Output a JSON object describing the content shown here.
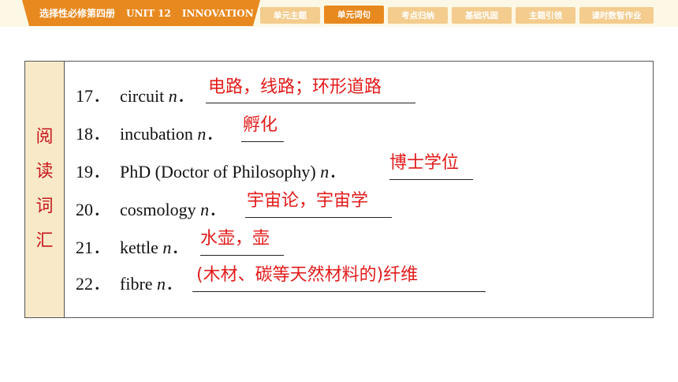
{
  "header": {
    "title_cn": "选择性必修第四册",
    "title_unit": "UNIT 12",
    "title_theme": "INNOVATION"
  },
  "nav": {
    "tabs": [
      {
        "label": "单元主题",
        "active": false
      },
      {
        "label": "单元词句",
        "active": true
      },
      {
        "label": "考点归纳",
        "active": false
      },
      {
        "label": "基础巩固",
        "active": false
      },
      {
        "label": "主题引领",
        "active": false
      },
      {
        "label": "课时数智作业",
        "active": false
      }
    ]
  },
  "section": {
    "label_chars": [
      "阅",
      "读",
      "词",
      "汇"
    ]
  },
  "vocab": [
    {
      "num": "17．",
      "word": "circuit",
      "pos": "n",
      "answer": "电路，线路；环形道路"
    },
    {
      "num": "18．",
      "word": "incubation",
      "pos": "n",
      "answer": "孵化"
    },
    {
      "num": "19．",
      "word": "PhD (Doctor of Philosophy)",
      "pos": "n",
      "answer": "博士学位"
    },
    {
      "num": "20．",
      "word": "cosmology",
      "pos": "n",
      "answer": "宇宙论，宇宙学"
    },
    {
      "num": "21．",
      "word": "kettle",
      "pos": "n",
      "answer": "水壶，壶"
    },
    {
      "num": "22．",
      "word": "fibre",
      "pos": "n",
      "answer": "(木材、碳等天然材料的)纤维"
    }
  ],
  "colors": {
    "accent": "#e8891f",
    "tab_inactive": "#f3cc8e",
    "answer": "#e21b1b",
    "side_bg": "#f8eac8"
  }
}
